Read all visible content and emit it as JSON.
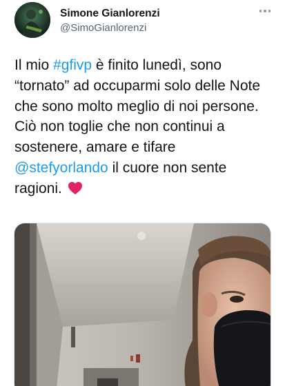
{
  "author": {
    "name": "Simone Gianlorenzi",
    "handle": "@SimoGianlorenzi",
    "avatar_icon": "profile-photo"
  },
  "menu": {
    "icon": "more-horizontal-icon"
  },
  "tweet": {
    "line1_pre": "Il mio ",
    "hashtag": "#gfivp",
    "line1_post": " è finito lunedì, sono",
    "line2": "“tornato” ad occuparmi solo delle Note",
    "line3": "che sono molto meglio di noi persone.",
    "line4": "Ciò non toglie che non continui a",
    "line5": "sostenere, amare e tifare",
    "mention": "@stefyorlando",
    "line6_post": " il cuore non sente",
    "line7": "ragioni. ",
    "emoji": "red-heart-icon"
  },
  "media": {
    "icon": "photo-selfie-with-mask"
  },
  "colors": {
    "link": "#1d9bf0",
    "text": "#0f1419",
    "secondary": "#536471",
    "heart": "#e0245e"
  }
}
